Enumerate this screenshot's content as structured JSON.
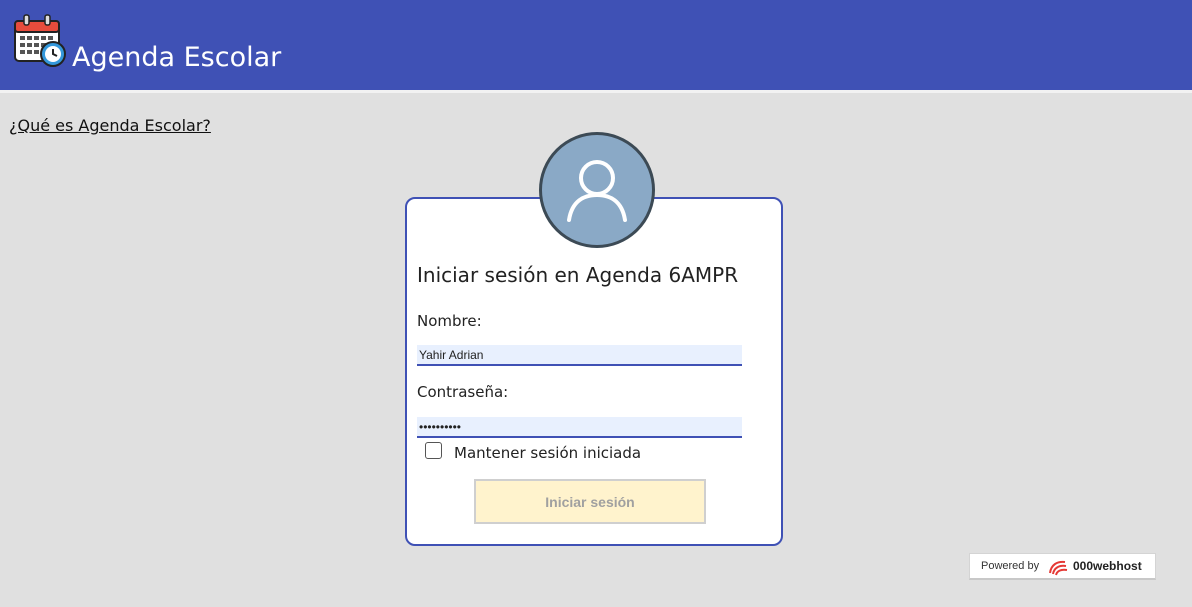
{
  "header": {
    "app_title": "Agenda Escolar",
    "logo_icon": "calendar-clock-icon"
  },
  "about_link": "¿Qué es Agenda Escolar?",
  "login": {
    "title": "Iniciar sesión en Agenda 6AMPR",
    "avatar_icon": "user-avatar-icon",
    "username_label": "Nombre:",
    "username_value": "Yahir Adrian",
    "password_label": "Contraseña:",
    "password_value": "••••••••••",
    "remember_label": "Mantener sesión iniciada",
    "remember_checked": false,
    "submit_label": "Iniciar sesión"
  },
  "footer": {
    "powered_by": "Powered by",
    "host_name": "000webhost",
    "host_icon": "000webhost-logo-icon"
  },
  "colors": {
    "header": "#3f51b5",
    "background": "#e0e0e0",
    "button_bg": "#fff3cd",
    "avatar_bg": "#8aa9c6"
  }
}
